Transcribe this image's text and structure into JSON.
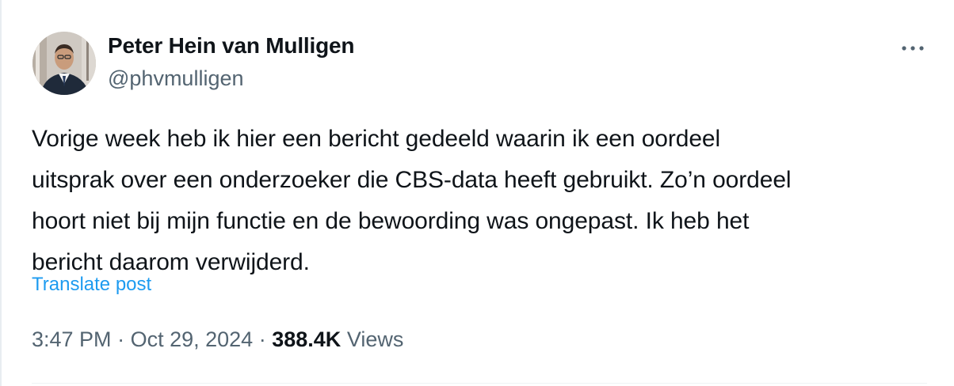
{
  "author": {
    "display_name": "Peter Hein van Mulligen",
    "handle": "@phvmulligen"
  },
  "post": {
    "lines": [
      "Vorige week heb ik hier een bericht gedeeld waarin ik een oordeel",
      "uitsprak over een onderzoeker die CBS-data heeft gebruikt. Zo’n oordeel",
      "hoort niet bij mijn functie en de bewoording was ongepast. Ik heb het",
      "bericht daarom verwijderd."
    ],
    "translate_label": "Translate post"
  },
  "meta": {
    "time": "3:47 PM",
    "separator": "·",
    "date": "Oct 29, 2024",
    "views_count": "388.4K",
    "views_label": "Views"
  },
  "icons": {
    "more": "more-horizontal-icon",
    "avatar": "profile-photo"
  },
  "colors": {
    "text_primary": "#0f1419",
    "text_secondary": "#536471",
    "link": "#1d9bf0"
  }
}
